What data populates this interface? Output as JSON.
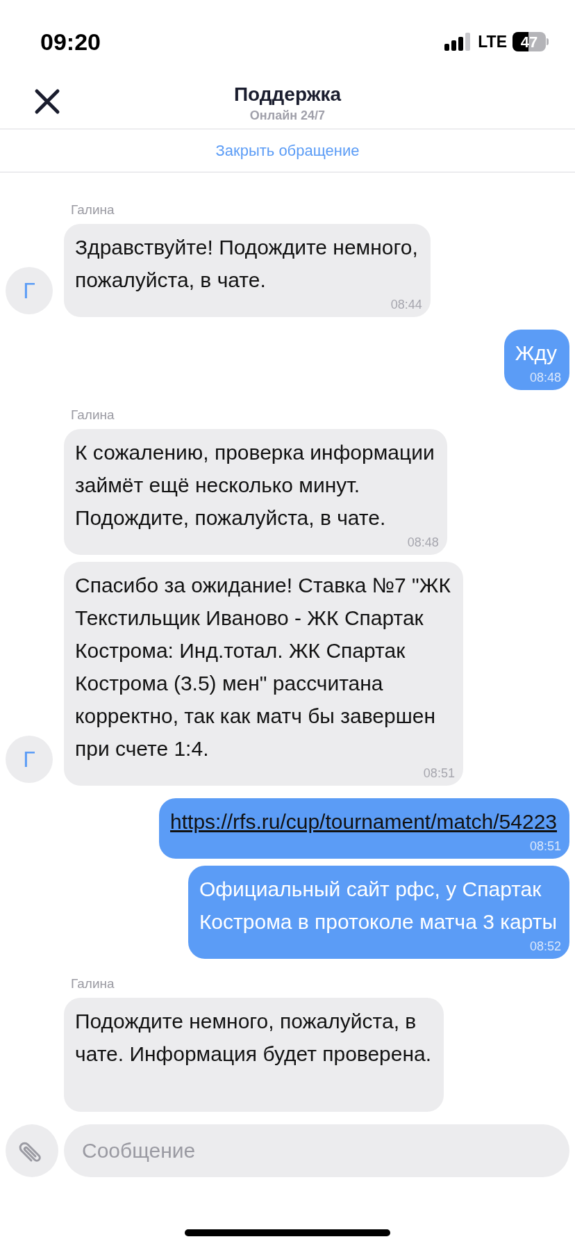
{
  "status_bar": {
    "time": "09:20",
    "network": "LTE",
    "battery": "47"
  },
  "header": {
    "title": "Поддержка",
    "subtitle": "Онлайн 24/7"
  },
  "close_ticket": "Закрыть обращение",
  "messages": [
    {
      "kind": "text",
      "outgoing": false,
      "sender": "Галина",
      "avatar": "Г",
      "lines": [
        "Здравствуйте! Подождите немного,",
        "пожалуйста, в чате."
      ],
      "time": "08:44"
    },
    {
      "kind": "text",
      "outgoing": true,
      "lines": [
        "Жду"
      ],
      "time": "08:48"
    },
    {
      "kind": "text",
      "outgoing": false,
      "sender": "Галина",
      "lines": [
        "К сожалению, проверка информации",
        "займёт ещё несколько минут.",
        "Подождите, пожалуйста, в чате."
      ],
      "time": "08:48"
    },
    {
      "kind": "text",
      "outgoing": false,
      "avatar": "Г",
      "lines": [
        "Спасибо за ожидание! Ставка №7 \"ЖК",
        "Текстильщик Иваново - ЖК Спартак",
        "Кострома: Инд.тотал. ЖК Спартак",
        "Кострома (3.5) мен\" рассчитана",
        "корректно, так как матч бы завершен",
        "при счете 1:4."
      ],
      "time": "08:51"
    },
    {
      "kind": "link",
      "outgoing": true,
      "lines": [
        "https://rfs.ru/cup/tournament/match/54223"
      ],
      "time": "08:51"
    },
    {
      "kind": "text",
      "outgoing": true,
      "lines": [
        "Официальный сайт рфс, у Спартак",
        "Кострома в протоколе матча 3 карты"
      ],
      "time": "08:52"
    },
    {
      "kind": "text",
      "outgoing": false,
      "sender": "Галина",
      "lines": [
        "Подождите немного, пожалуйста, в",
        "чате. Информация будет проверена."
      ]
    }
  ],
  "composer": {
    "placeholder": "Сообщение"
  }
}
